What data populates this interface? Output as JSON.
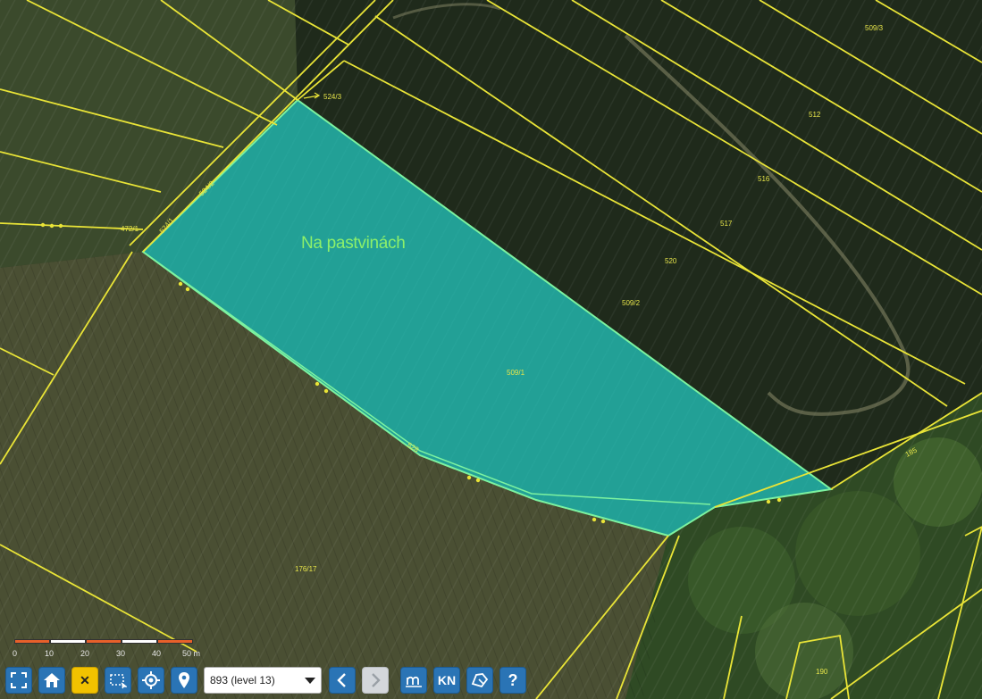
{
  "map": {
    "area_name": "Na pastvinách",
    "parcel_labels": [
      "524/3",
      "509/3",
      "512",
      "516",
      "517",
      "520",
      "509/2",
      "509/1",
      "472/1",
      "524/1",
      "524/2",
      "528",
      "176/17",
      "185",
      "190"
    ],
    "colors": {
      "parcel_line": "#e9e437",
      "selection_fill": "#1fc8c4",
      "selection_border": "#7cf2a0",
      "area_label": "#8df06a"
    }
  },
  "scale_bar": {
    "ticks": [
      "0",
      "10",
      "20",
      "30",
      "40",
      "50 m"
    ],
    "colors": [
      "#e8602a",
      "#ffffff",
      "#e8602a",
      "#ffffff",
      "#e8602a"
    ]
  },
  "toolbar": {
    "icons": {
      "fullscreen": "fullscreen-icon",
      "home": "home-icon",
      "clear": "close-icon",
      "select_area": "select-rectangle-icon",
      "locate": "crosshair-icon",
      "marker": "map-marker-icon",
      "back": "chevron-left-icon",
      "forward": "chevron-right-icon",
      "measure": "measure-icon",
      "cadastre": "cadastre-icon",
      "parcel": "parcel-shape-icon",
      "help": "help-icon"
    },
    "clear_label": "✕",
    "zoom_select_value": "893 (level 13)",
    "kn_label": "KN",
    "help_label": "?"
  }
}
